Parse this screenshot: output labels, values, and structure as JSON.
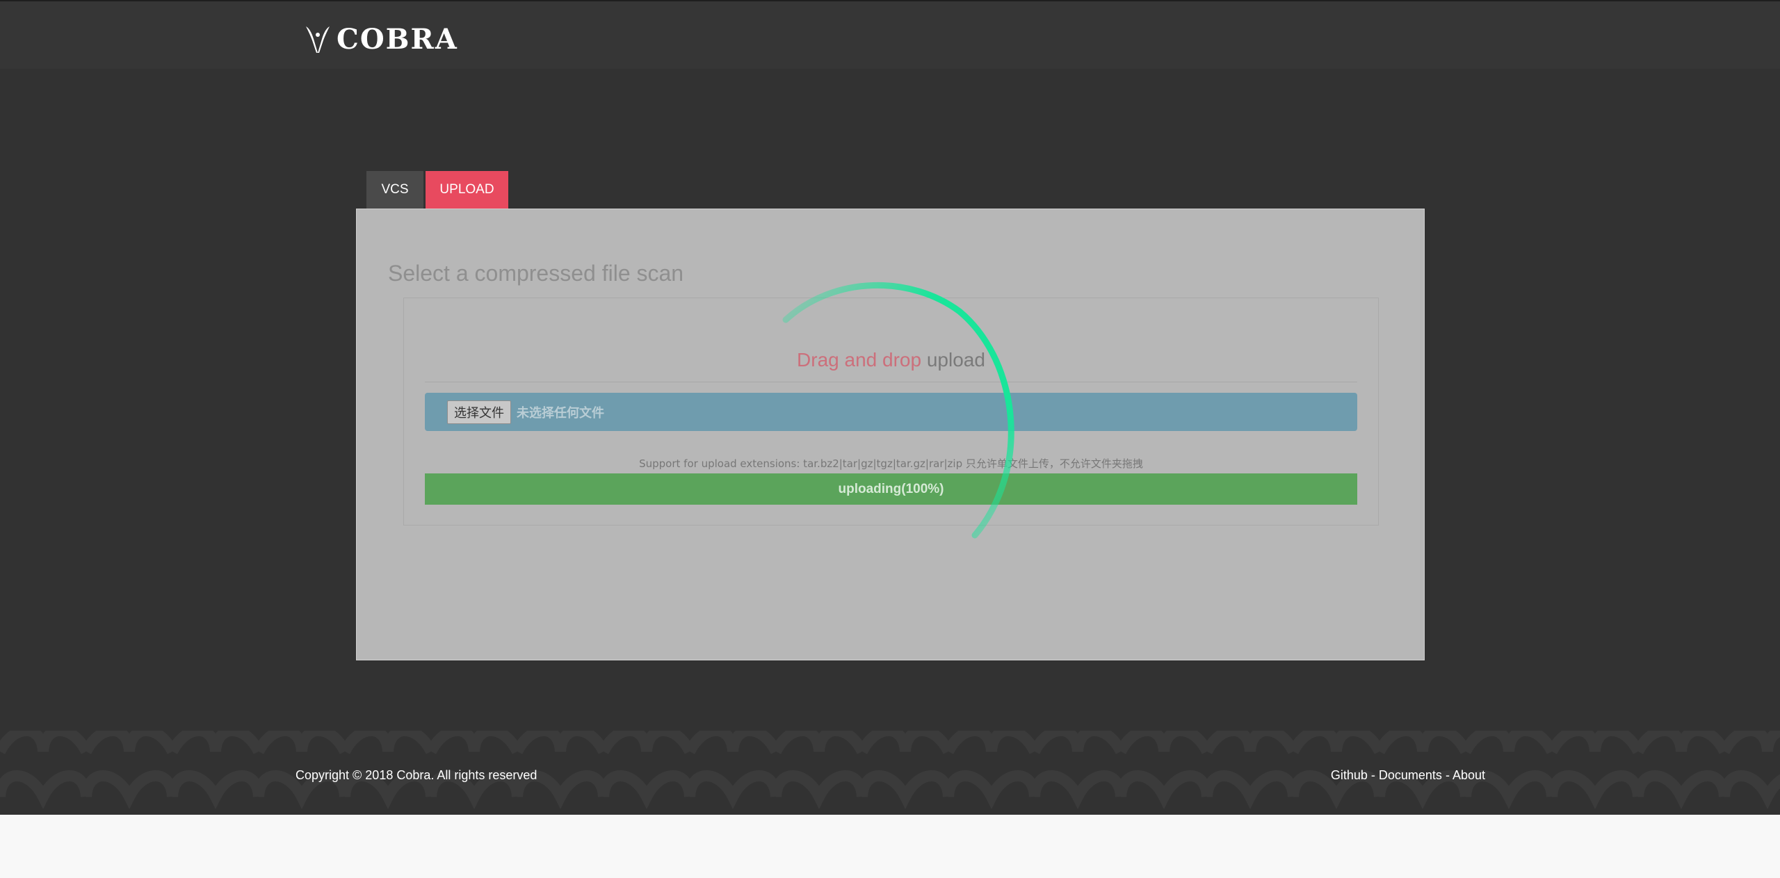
{
  "header": {
    "brand": "COBRA"
  },
  "tabs": [
    {
      "label": "VCS",
      "active": false
    },
    {
      "label": "UPLOAD",
      "active": true
    }
  ],
  "panel": {
    "title": "Select a compressed file scan",
    "drop_highlight": "Drag and drop",
    "drop_rest": " upload",
    "file_input": {
      "button_label": "选择文件",
      "status": "未选择任何文件"
    },
    "support_text": "Support for upload extensions: tar.bz2|tar|gz|tgz|tar.gz|rar|zip 只允许单文件上传，不允许文件夹拖拽",
    "progress": {
      "label": "uploading(100%)",
      "percent": 100
    }
  },
  "footer": {
    "copyright": "Copyright © 2018 Cobra. All rights reserved",
    "links": [
      "Github",
      "Documents",
      "About"
    ],
    "separator": " - "
  },
  "colors": {
    "background": "#323232",
    "accent_tab": "#e84a5f",
    "progress": "#5ba45b",
    "spinner": "#19e59a"
  }
}
